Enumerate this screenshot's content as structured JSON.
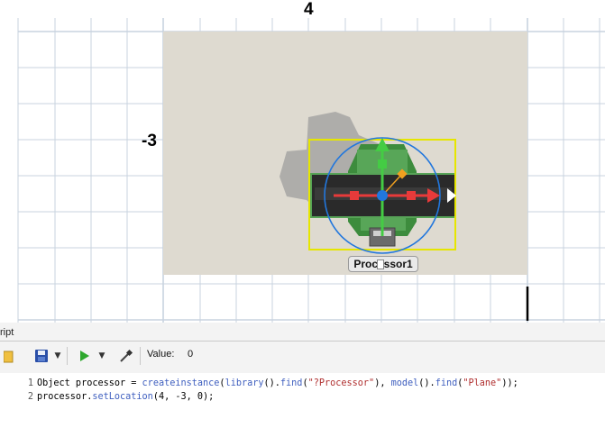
{
  "viewport": {
    "coord_x_label": "4",
    "coord_y_label": "-3",
    "object_label": "Processor1",
    "colors": {
      "background": "#ffffff",
      "grid_line": "#c8d3df",
      "floor": "#dedad0",
      "selection_box": "#e6e600",
      "gizmo_circle": "#2277dd",
      "x_axis": "#e83a3a",
      "y_axis": "#44cc44",
      "model_green": "#3d8c3d",
      "model_dark": "#2a2a2a"
    }
  },
  "script_panel": {
    "title": "ript",
    "toolbar": {
      "icons": [
        "save-icon",
        "dropdown-icon",
        "run-icon",
        "dropdown-icon",
        "eyedropper-icon"
      ],
      "value_label": "Value:",
      "value": "0"
    },
    "code": {
      "lines": [
        {
          "number": "1",
          "tokens": [
            {
              "t": "Object processor = ",
              "c": "plain"
            },
            {
              "t": "createinstance",
              "c": "kw"
            },
            {
              "t": "(",
              "c": "plain"
            },
            {
              "t": "library",
              "c": "kw"
            },
            {
              "t": "().",
              "c": "plain"
            },
            {
              "t": "find",
              "c": "kw"
            },
            {
              "t": "(",
              "c": "plain"
            },
            {
              "t": "\"?Processor\"",
              "c": "str"
            },
            {
              "t": "), ",
              "c": "plain"
            },
            {
              "t": "model",
              "c": "kw"
            },
            {
              "t": "().",
              "c": "plain"
            },
            {
              "t": "find",
              "c": "kw"
            },
            {
              "t": "(",
              "c": "plain"
            },
            {
              "t": "\"Plane\"",
              "c": "str"
            },
            {
              "t": "));",
              "c": "plain"
            }
          ]
        },
        {
          "number": "2",
          "tokens": [
            {
              "t": "processor.",
              "c": "plain"
            },
            {
              "t": "setLocation",
              "c": "kw"
            },
            {
              "t": "(4, -3, 0);",
              "c": "plain"
            }
          ]
        }
      ]
    }
  }
}
